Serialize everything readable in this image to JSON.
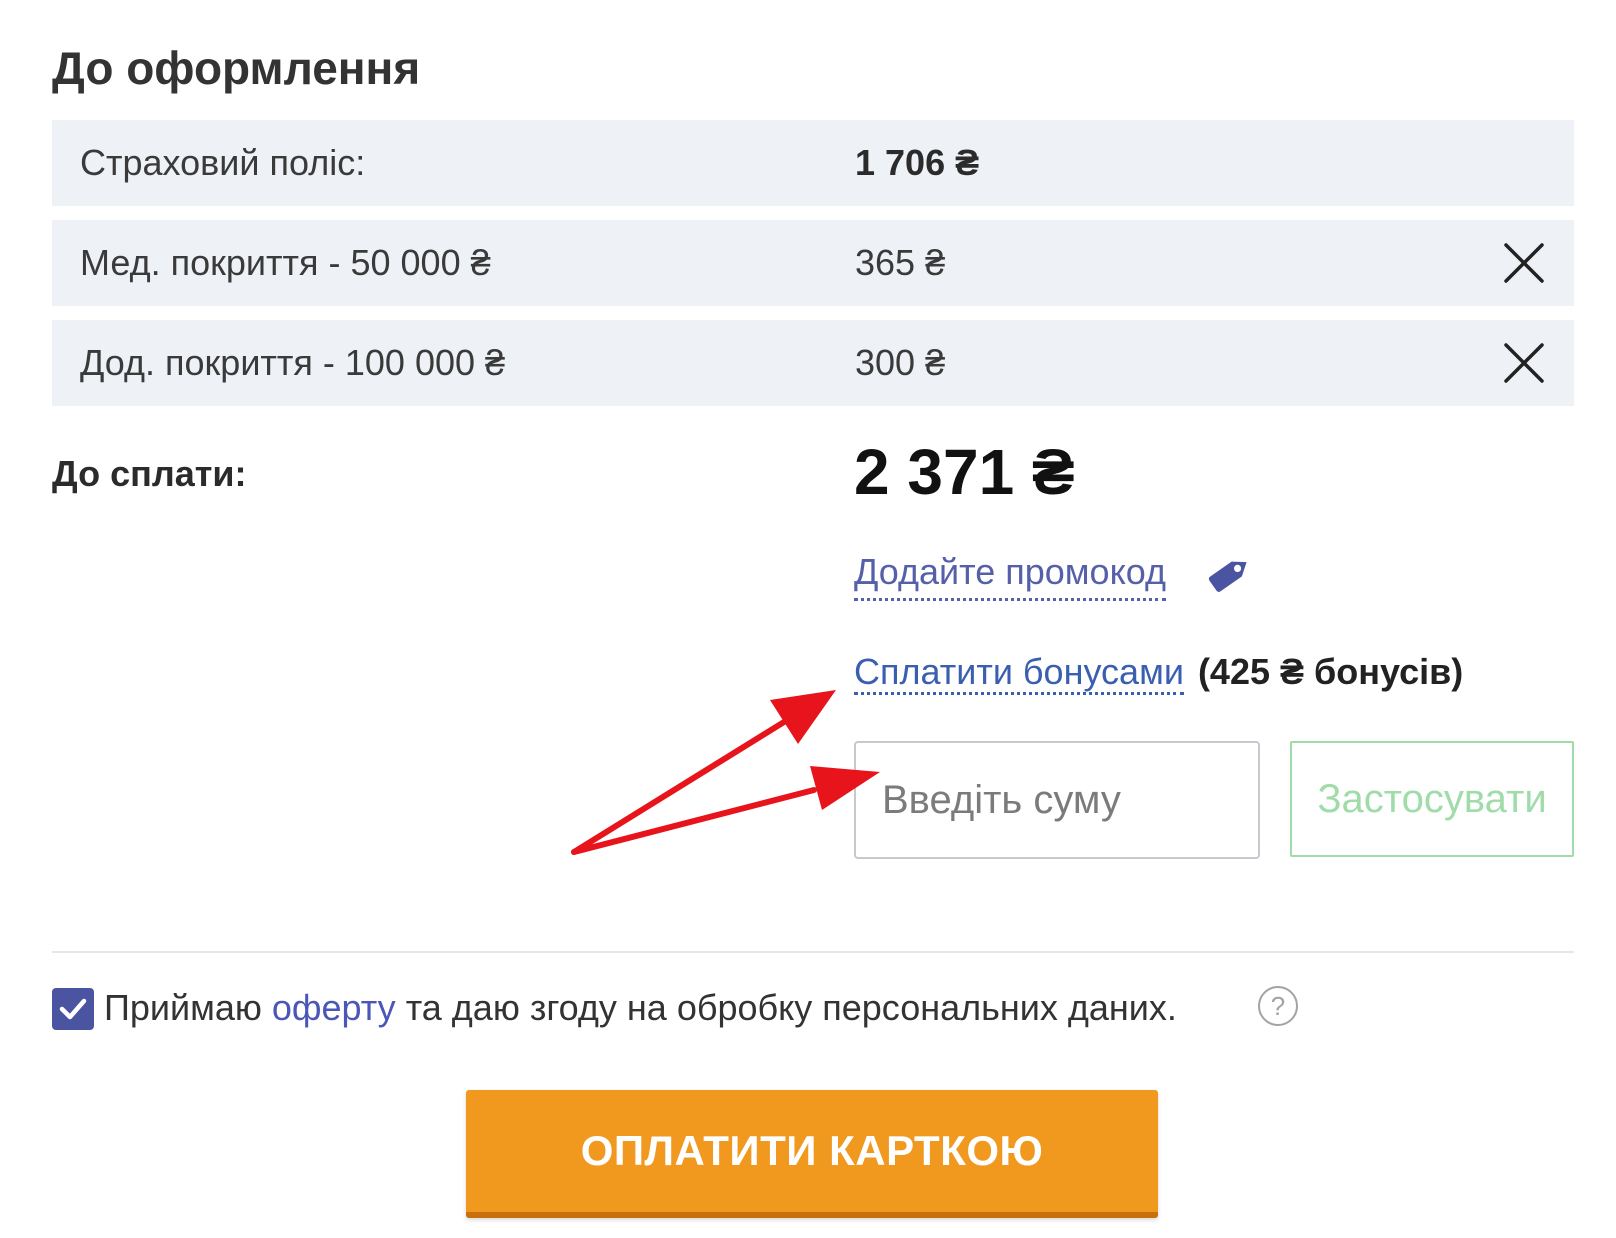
{
  "page_title": "До оформлення",
  "line_items": [
    {
      "label": "Страховий поліс:",
      "value": "1 706 ₴"
    },
    {
      "label": "Мед. покриття - 50 000 ₴",
      "value": "365 ₴"
    },
    {
      "label": "Дод. покриття - 100 000 ₴",
      "value": "300 ₴"
    }
  ],
  "total": {
    "label": "До сплати:",
    "value": "2 371 ₴"
  },
  "promo": {
    "link_label": "Додайте промокод",
    "icon": "tag-icon"
  },
  "bonus": {
    "link_label": "Сплатити бонусами",
    "amount_label": "(425 ₴ бонусів)",
    "input_placeholder": "Введіть суму",
    "apply_label": "Застосувати"
  },
  "consent": {
    "prefix": "Приймаю ",
    "offer_link": "оферту",
    "suffix": " та даю згоду на обробку персональних даних.",
    "checked": true,
    "help_icon": "?"
  },
  "pay_button_label": "ОПЛАТИТИ КАРТКОЮ",
  "colors": {
    "accent_link": "#5560a8",
    "pay_button": "#f1991f",
    "apply_border": "#9fdca9",
    "annotation_arrow": "#e8141c",
    "row_background": "#eef1f6"
  }
}
